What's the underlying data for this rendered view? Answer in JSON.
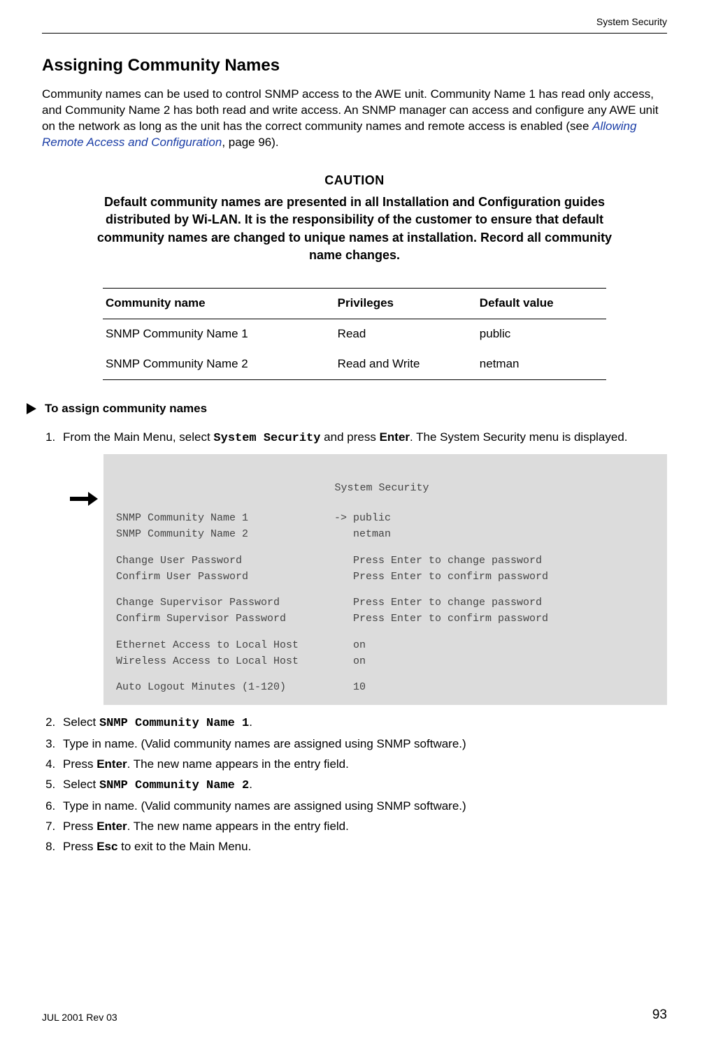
{
  "running_head": "System Security",
  "heading": "Assigning Community Names",
  "intro_part1": "Community names can be used to control SNMP access to the AWE unit. Community Name 1 has read only access, and Community Name 2 has both read and write access. An SNMP manager can access and configure any AWE unit on the network as long as the unit has the correct community names and remote access is enabled (see ",
  "intro_xref": "Allowing Remote Access and Configuration",
  "intro_part2": ", page 96).",
  "caution_title": "CAUTION",
  "caution_body": "Default community names are presented in all Installation and Configuration guides distributed by Wi-LAN. It is the responsibility of the customer to ensure that default community names are changed to unique names at installation. Record all community name changes.",
  "table": {
    "headers": [
      "Community name",
      "Privileges",
      "Default value"
    ],
    "rows": [
      [
        "SNMP Community Name 1",
        "Read",
        "public"
      ],
      [
        "SNMP Community Name 2",
        "Read and Write",
        "netman"
      ]
    ]
  },
  "proc_title": "To assign community names",
  "steps": {
    "s1_a": "From the Main Menu, select ",
    "s1_b": "System Security",
    "s1_c": " and press ",
    "s1_d": "Enter",
    "s1_e": ". The System Security menu is displayed.",
    "s2_a": "Select ",
    "s2_b": "SNMP Community Name 1",
    "s2_c": ".",
    "s3": "Type in name. (Valid community names are assigned using SNMP software.)",
    "s4_a": "Press ",
    "s4_b": "Enter",
    "s4_c": ". The new name appears in the entry field.",
    "s5_a": "Select ",
    "s5_b": "SNMP Community Name 2",
    "s5_c": ".",
    "s6": "Type in name. (Valid community names are assigned using SNMP software.)",
    "s7_a": "Press ",
    "s7_b": "Enter",
    "s7_c": ". The new name appears in the entry field.",
    "s8_a": "Press ",
    "s8_b": "Esc",
    "s8_c": " to exit to the Main Menu."
  },
  "screen": {
    "title": "System Security",
    "lines": [
      {
        "label": "SNMP Community Name 1",
        "arrow": "->",
        "value": "public"
      },
      {
        "label": "SNMP Community Name 2",
        "arrow": "",
        "value": "netman"
      }
    ],
    "lines2": [
      {
        "label": "Change User Password",
        "value": "Press Enter to change password"
      },
      {
        "label": "Confirm User Password",
        "value": "Press Enter to confirm password"
      }
    ],
    "lines3": [
      {
        "label": "Change Supervisor Password",
        "value": "Press Enter to change password"
      },
      {
        "label": "Confirm Supervisor Password",
        "value": "Press Enter to confirm password"
      }
    ],
    "lines4": [
      {
        "label": "Ethernet Access to Local Host",
        "value": "on"
      },
      {
        "label": "Wireless Access to Local Host",
        "value": "on"
      }
    ],
    "lines5": [
      {
        "label": "Auto Logout Minutes (1-120)",
        "value": "10"
      }
    ]
  },
  "footer_left": "JUL 2001 Rev 03",
  "footer_right": "93"
}
